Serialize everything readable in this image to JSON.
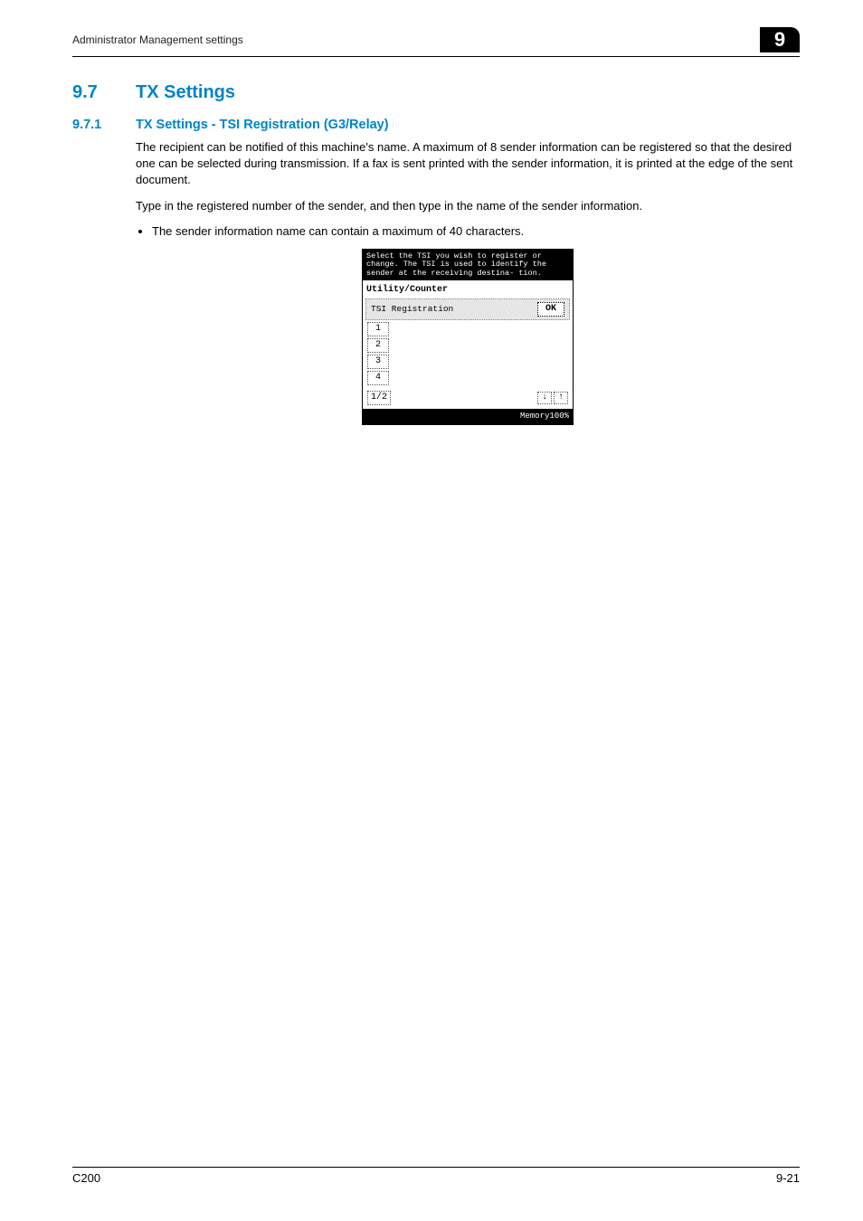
{
  "header": {
    "left": "Administrator Management settings",
    "chapter": "9"
  },
  "section": {
    "number": "9.7",
    "title": "TX Settings"
  },
  "subsection": {
    "number": "9.7.1",
    "title": "TX Settings - TSI Registration (G3/Relay)"
  },
  "paragraphs": {
    "p1": "The recipient can be notified of this machine's name. A maximum of 8 sender information can be registered so that the desired one can be selected during transmission. If a fax is sent printed with the sender information, it is printed at the edge of the sent document.",
    "p2": "Type in the registered number of the sender, and then type in the name of the sender information.",
    "bullet1": "The sender information name can contain a maximum of 40 characters."
  },
  "dialog": {
    "instruction": "Select the TSI you wish to register or change.  The TSI is used to identify the sender at the receiving destina- tion.",
    "breadcrumb": "Utility/Counter",
    "panel_title": "TSI Registration",
    "ok": "OK",
    "items": [
      "1",
      "2",
      "3",
      "4"
    ],
    "page_indicator": "1/2",
    "arrow_down": "↓",
    "arrow_up": "↑",
    "memory": "Memory100%"
  },
  "footer": {
    "left": "C200",
    "right": "9-21"
  }
}
